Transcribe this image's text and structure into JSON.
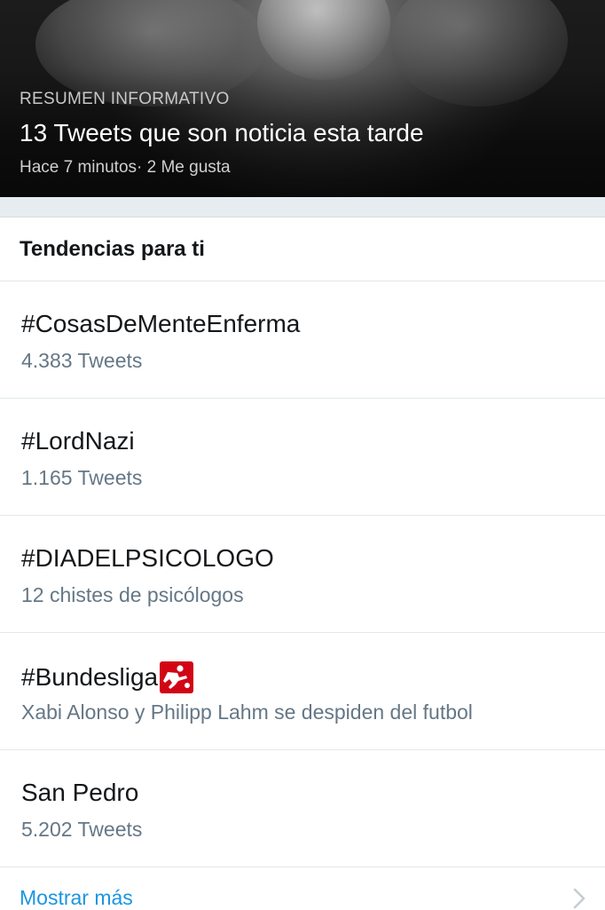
{
  "moment": {
    "label": "RESUMEN INFORMATIVO",
    "title": "13 Tweets que son noticia esta tarde",
    "meta": "Hace 7 minutos· 2 Me gusta"
  },
  "trends": {
    "header": "Tendencias para ti",
    "items": [
      {
        "name": "#CosasDeMenteEnferma",
        "sub": "4.383 Tweets"
      },
      {
        "name": "#LordNazi",
        "sub": "1.165 Tweets"
      },
      {
        "name": "#DIADELPSICOLOGO",
        "sub": "12 chistes de psicólogos"
      },
      {
        "name": "#Bundesliga",
        "sub": "Xabi Alonso y Philipp Lahm se despiden del futbol",
        "icon": "bundesliga-logo-icon"
      },
      {
        "name": "San Pedro",
        "sub": "5.202 Tweets"
      }
    ],
    "show_more": "Mostrar más"
  },
  "colors": {
    "link": "#1b95e0",
    "secondary_text": "#657786",
    "divider_band": "#e6ecf0",
    "bundesliga_red": "#d20515"
  }
}
